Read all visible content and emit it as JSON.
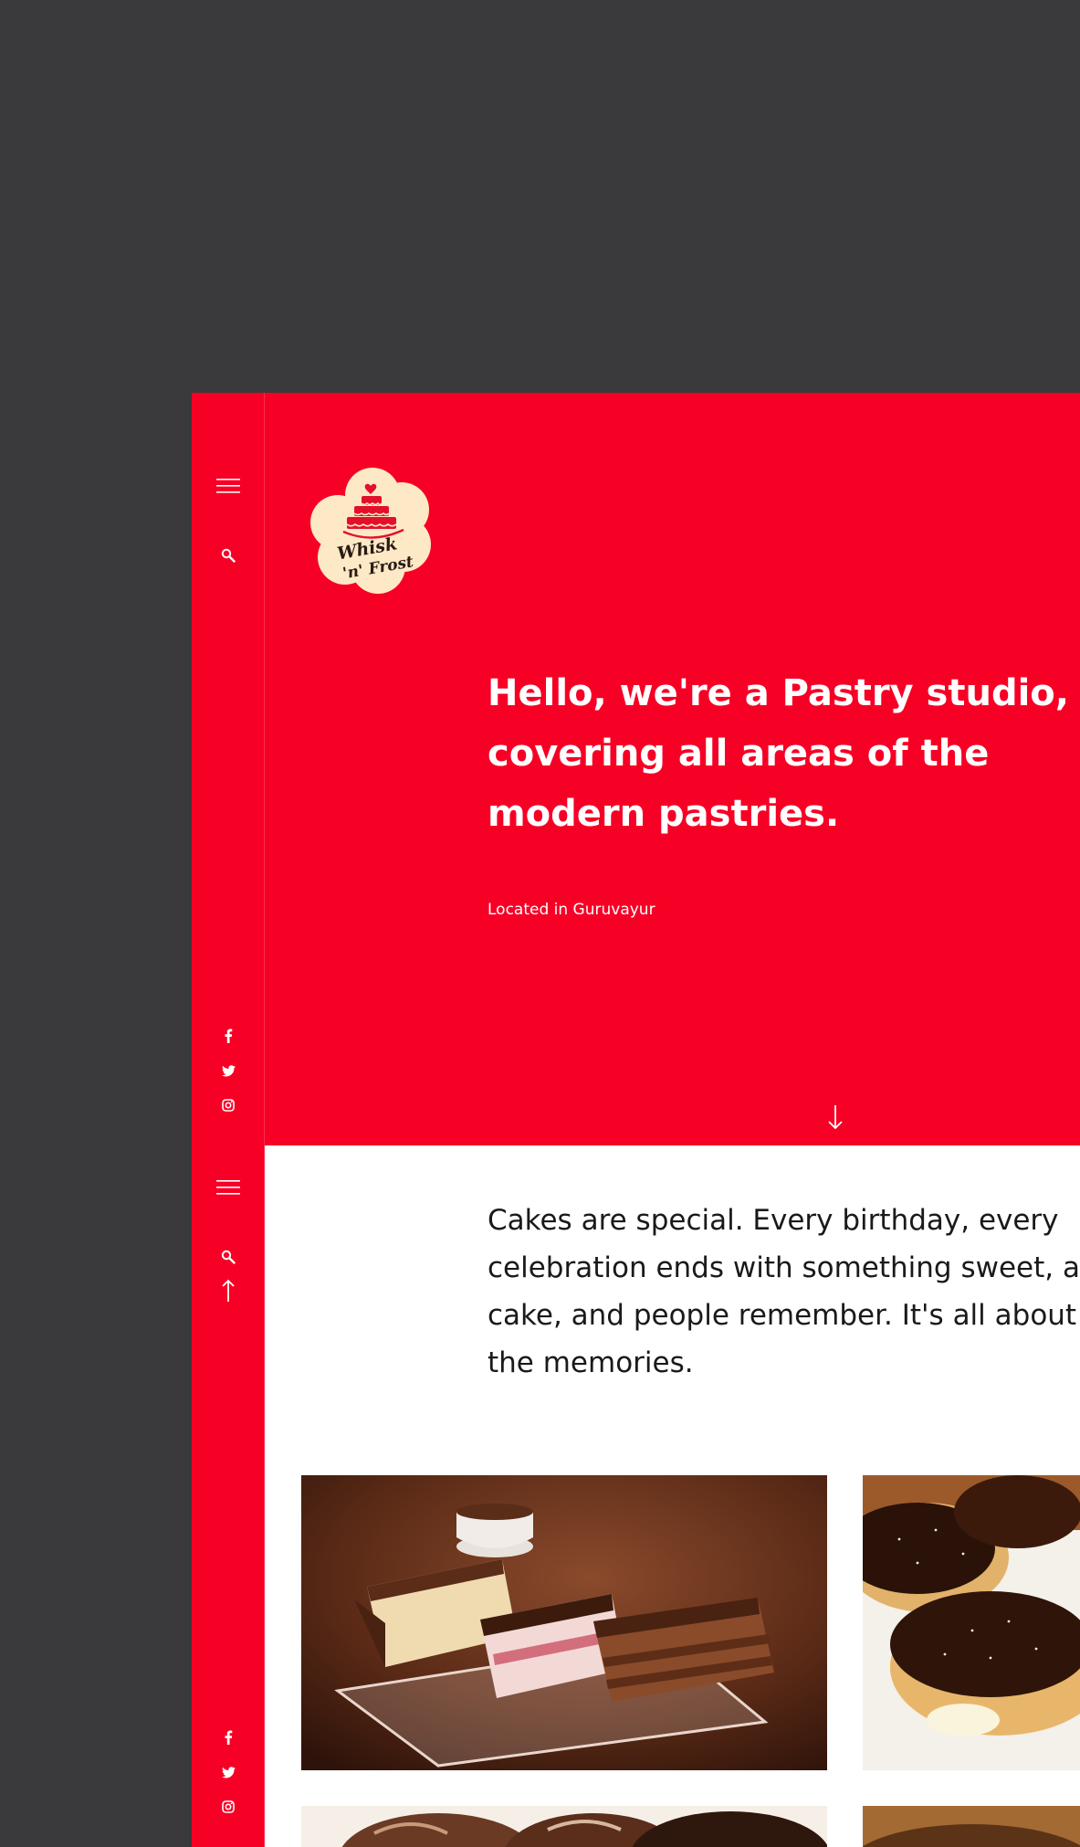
{
  "brand": {
    "logo_line1": "Whisk",
    "logo_line2": "'n' Frost"
  },
  "colors": {
    "backdrop": "#3a393b",
    "brand_red": "#f70025",
    "logo_cream": "#fde9c6",
    "text_dark": "#1a1a1a"
  },
  "sidebar": {
    "top_icons": [
      "menu-icon",
      "search-icon"
    ],
    "social_icons": [
      "facebook-icon",
      "twitter-icon",
      "instagram-icon"
    ],
    "sticky_icons": [
      "menu-icon",
      "search-icon",
      "arrow-up-icon"
    ]
  },
  "hero": {
    "title": "Hello, we're a Pastry studio, covering all areas of the modern pastries.",
    "location": "Located in Guruvayur",
    "scroll_icon": "arrow-down-icon"
  },
  "intro": {
    "text": "Cakes are special. Every birthday, every celebration ends with something sweet, a cake, and people remember. It's all about the memories."
  },
  "gallery": {
    "items": [
      {
        "name": "layered cake slices"
      },
      {
        "name": "chocolate eclairs"
      },
      {
        "name": "chocolate truffles"
      },
      {
        "name": "cookies"
      }
    ]
  }
}
